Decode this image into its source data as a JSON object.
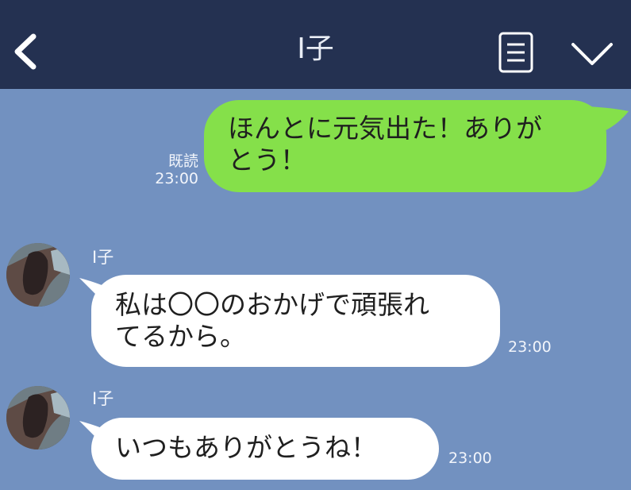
{
  "header": {
    "title": "I子",
    "icons": {
      "back": "back-chevron-icon",
      "menu": "menu-list-icon",
      "collapse": "chevron-down-icon"
    }
  },
  "colors": {
    "header_bg": "#243151",
    "chat_bg": "#7291c0",
    "outgoing_bubble": "#85e04a",
    "incoming_bubble": "#ffffff"
  },
  "messages": [
    {
      "direction": "outgoing",
      "lines": [
        "ほんとに元気出た！ありが",
        "とう！"
      ],
      "read_label": "既読",
      "time": "23:00"
    },
    {
      "direction": "incoming",
      "sender": "I子",
      "lines": [
        "私は〇〇のおかげで頑張れ",
        "てるから。"
      ],
      "time": "23:00"
    },
    {
      "direction": "incoming",
      "sender": "I子",
      "lines": [
        "いつもありがとうね！"
      ],
      "time": "23:00"
    }
  ]
}
